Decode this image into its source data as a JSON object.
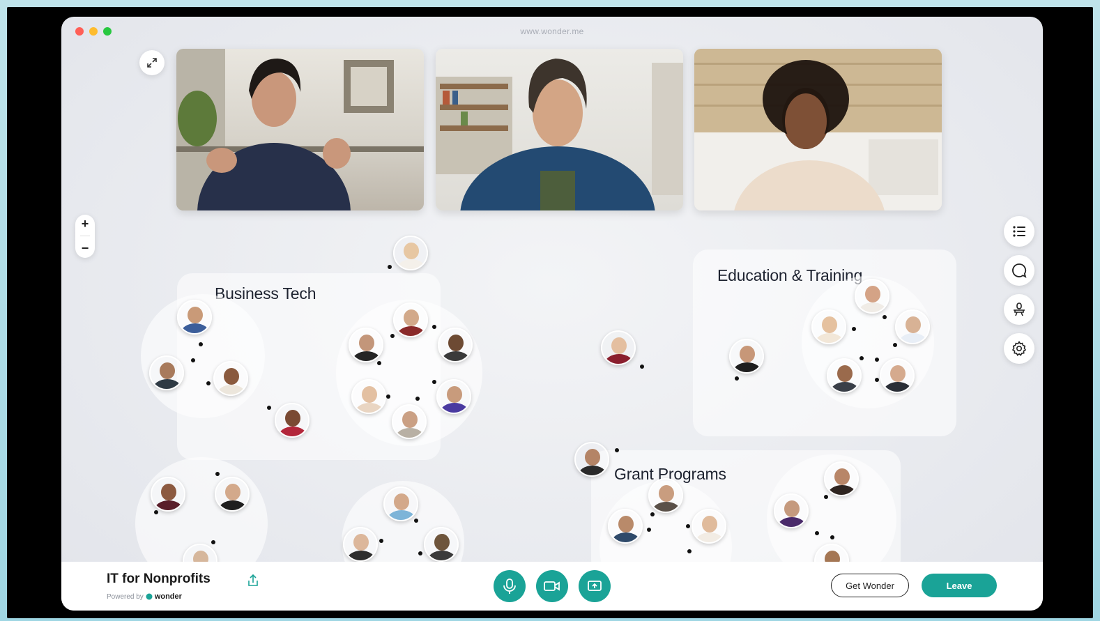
{
  "window": {
    "url": "www.wonder.me"
  },
  "rooms": [
    {
      "title": "Business Tech"
    },
    {
      "title": "Education & Training"
    },
    {
      "title": "Grant Programs"
    }
  ],
  "footer": {
    "room_name": "IT for Nonprofits",
    "powered_by": "Powered by",
    "brand": "wonder",
    "get_label": "Get Wonder",
    "leave_label": "Leave"
  },
  "zoom": {
    "plus": "+",
    "minus": "−"
  },
  "icons": [
    "expand-icon",
    "list-icon",
    "chat-icon",
    "broadcast-icon",
    "settings-icon",
    "share-icon",
    "microphone-icon",
    "camera-icon",
    "screen-share-icon"
  ],
  "colors": {
    "accent": "#1aa397",
    "background": "#e8eaee"
  }
}
